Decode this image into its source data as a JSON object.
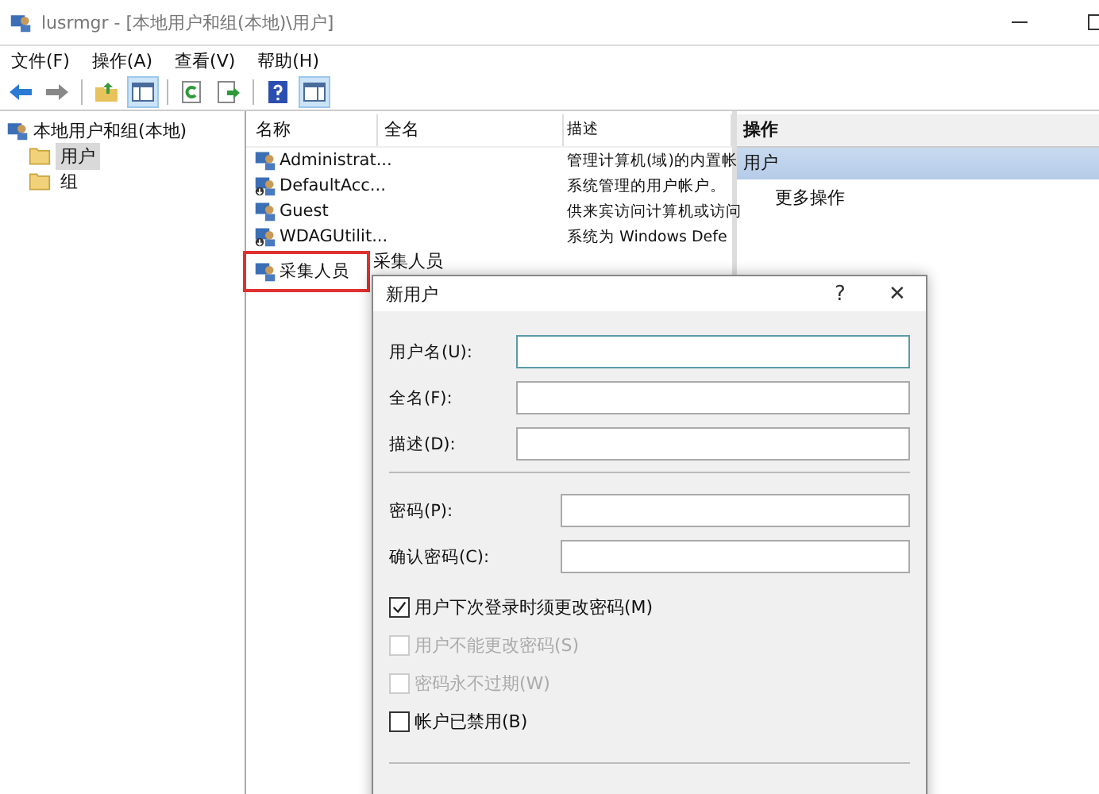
{
  "window": {
    "title": "lusrmgr - [本地用户和组(本地)\\用户]"
  },
  "menu": [
    {
      "label": "文件(F)"
    },
    {
      "label": "操作(A)"
    },
    {
      "label": "查看(V)"
    },
    {
      "label": "帮助(H)"
    }
  ],
  "toolbar": [
    {
      "kind": "back"
    },
    {
      "kind": "forward"
    },
    {
      "kind": "sep"
    },
    {
      "kind": "up",
      "pressed": false
    },
    {
      "kind": "tree",
      "pressed": true
    },
    {
      "kind": "sep"
    },
    {
      "kind": "refresh",
      "pressed": false
    },
    {
      "kind": "export",
      "pressed": false
    },
    {
      "kind": "sep"
    },
    {
      "kind": "help",
      "pressed": false
    },
    {
      "kind": "actions",
      "pressed": true
    }
  ],
  "tree": {
    "label": "本地用户和组(本地)",
    "children": [
      {
        "label": "用户",
        "selected": true
      },
      {
        "label": "组",
        "selected": false
      }
    ]
  },
  "list": {
    "columns": [
      "名称",
      "全名",
      "描述"
    ],
    "rows": [
      {
        "name": "Administrat...",
        "full_name": "",
        "description": "管理计算机(域)的内置帐",
        "disabled": false,
        "highlighted": false
      },
      {
        "name": "DefaultAcc...",
        "full_name": "",
        "description": "系统管理的用户帐户。",
        "disabled": true,
        "highlighted": false
      },
      {
        "name": "Guest",
        "full_name": "",
        "description": "供来宾访问计算机或访问",
        "disabled": false,
        "highlighted": false
      },
      {
        "name": "WDAGUtilit...",
        "full_name": "",
        "description": "系统为 Windows Defe",
        "disabled": true,
        "highlighted": false
      },
      {
        "name": "采集人员",
        "full_name": "采集人员",
        "description": "",
        "disabled": false,
        "highlighted": true
      }
    ]
  },
  "actions": {
    "title": "操作",
    "section": "用户",
    "items": [
      "更多操作"
    ]
  },
  "dialog": {
    "title": "新用户",
    "help": "?",
    "close": "✕",
    "account_fields": [
      {
        "label": "用户名(U):",
        "focused": true
      },
      {
        "label": "全名(F):",
        "focused": false
      },
      {
        "label": "描述(D):",
        "focused": false
      }
    ],
    "password_fields": [
      {
        "label": "密码(P):",
        "focused": false
      },
      {
        "label": "确认密码(C):",
        "focused": false
      }
    ],
    "checkboxes": [
      {
        "label": "用户下次登录时须更改密码(M)",
        "checked": true,
        "disabled": false
      },
      {
        "label": "用户不能更改密码(S)",
        "checked": false,
        "disabled": true
      },
      {
        "label": "密码永不过期(W)",
        "checked": false,
        "disabled": true
      },
      {
        "label": "帐户已禁用(B)",
        "checked": false,
        "disabled": false
      }
    ]
  }
}
